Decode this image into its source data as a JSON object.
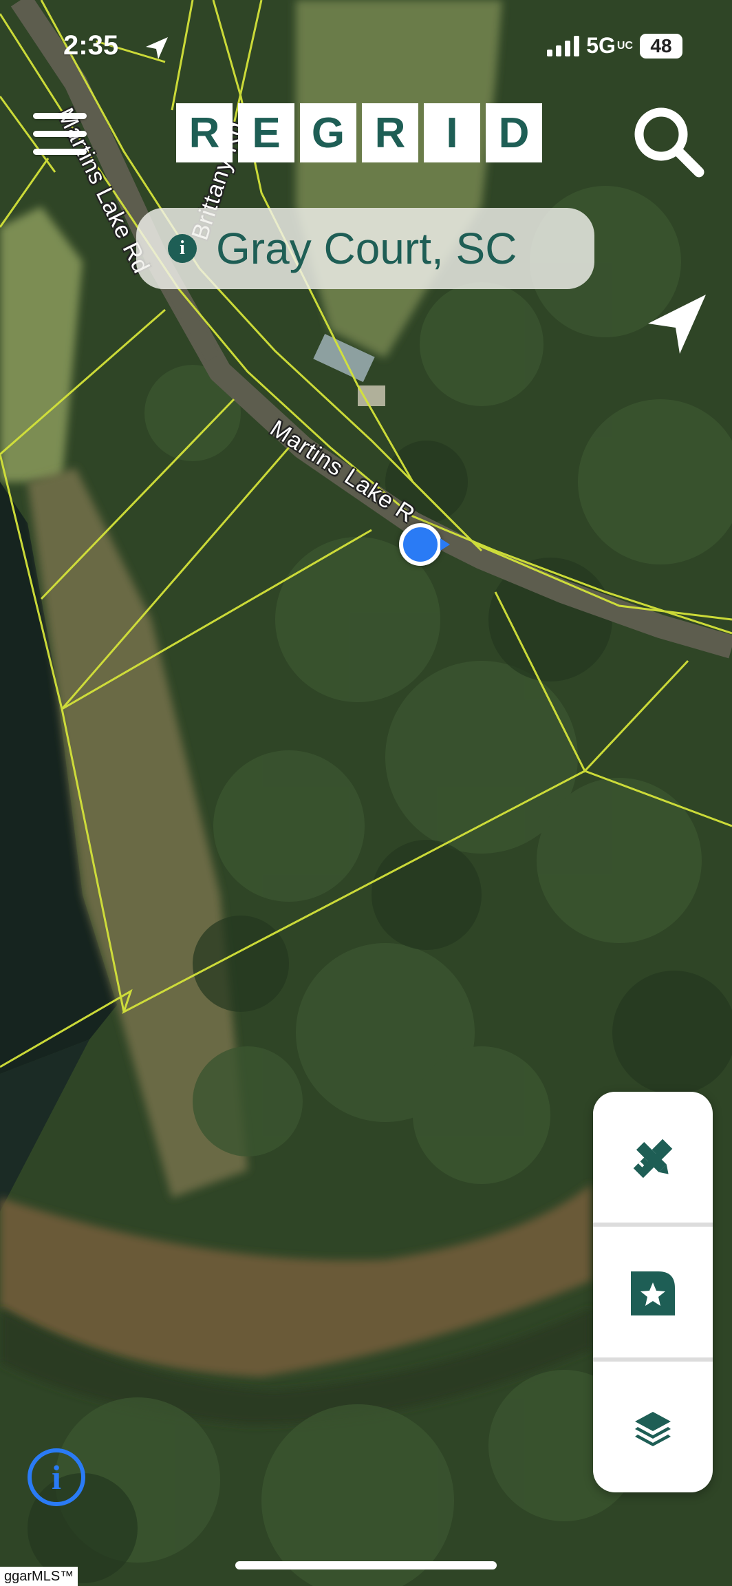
{
  "status_bar": {
    "time": "2:35",
    "network": "5G",
    "network_sub": "UC",
    "battery": "48"
  },
  "header": {
    "logo_letters": [
      "R",
      "E",
      "G",
      "R",
      "I",
      "D"
    ],
    "location_label": "Gray Court, SC",
    "menu_icon": "hamburger-menu-icon",
    "search_icon": "search-icon",
    "navigate_icon": "navigation-arrow-icon"
  },
  "map": {
    "road_labels": [
      "Martins Lake Rd",
      "Martins Lake R",
      "Brittany Rd"
    ],
    "parcel_line_color": "#d4e33a",
    "user_location_color": "#2a7bf5"
  },
  "tools": {
    "draw_icon": "ruler-pencil-icon",
    "saved_icon": "bookmark-star-icon",
    "layers_icon": "layers-icon",
    "accent_color": "#1e5e55"
  },
  "info_button_label": "i",
  "watermark": "ggarMLS™"
}
